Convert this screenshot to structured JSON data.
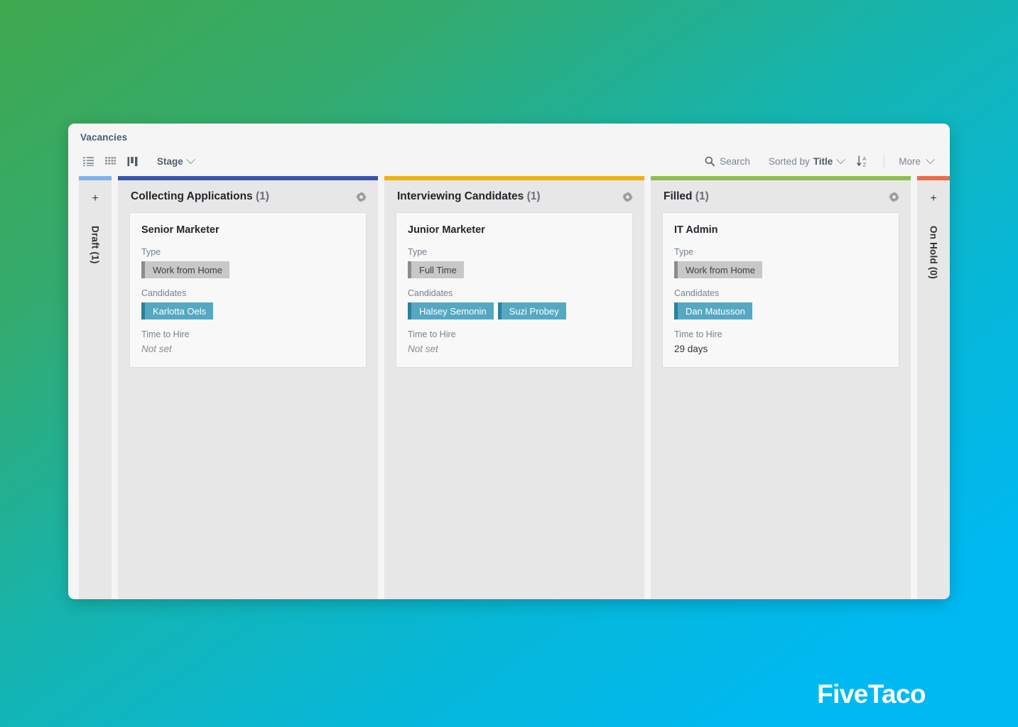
{
  "window": {
    "title": "Vacancies"
  },
  "toolbar": {
    "view_icons": [
      {
        "name": "list-view-icon",
        "label": "List view"
      },
      {
        "name": "grid-view-icon",
        "label": "Grid view"
      },
      {
        "name": "board-view-icon",
        "label": "Board view"
      }
    ],
    "stage_label": "Stage",
    "search_label": "Search",
    "sorted_by_label": "Sorted by",
    "sorted_by_value": "Title",
    "sort_direction_icon": "sort-alpha-ascending-icon",
    "more_label": "More"
  },
  "colors": {
    "draft": "#7fb2ef",
    "collecting": "#3a55ae",
    "interviewing": "#eeb111",
    "filled": "#8cbf4c",
    "onhold": "#ee6a45",
    "accent_person": "#55a8c2",
    "accent_type": "#c8c8c8",
    "brand_green": "#3ea84e",
    "brand_cyan": "#00b9f2"
  },
  "board": {
    "collapsed_left": {
      "label": "Draft (1)",
      "color": "#7fb2ef",
      "add_label": "+"
    },
    "collapsed_right": {
      "label": "On Hold (0)",
      "color": "#ee6a45",
      "add_label": "+"
    },
    "columns": [
      {
        "title": "Collecting Applications",
        "count": "(1)",
        "color": "#3a55ae",
        "card": {
          "title": "Senior Marketer",
          "type_label": "Type",
          "type_tags": [
            "Work from Home"
          ],
          "candidates_label": "Candidates",
          "candidates": [
            "Karlotta Oels"
          ],
          "time_label": "Time to Hire",
          "time_value": "Not set",
          "time_muted": true
        }
      },
      {
        "title": "Interviewing Candidates",
        "count": "(1)",
        "color": "#eeb111",
        "card": {
          "title": "Junior Marketer",
          "type_label": "Type",
          "type_tags": [
            "Full Time"
          ],
          "candidates_label": "Candidates",
          "candidates": [
            "Halsey Semonin",
            "Suzi Probey"
          ],
          "time_label": "Time to Hire",
          "time_value": "Not set",
          "time_muted": true
        }
      },
      {
        "title": "Filled",
        "count": "(1)",
        "color": "#8cbf4c",
        "card": {
          "title": "IT Admin",
          "type_label": "Type",
          "type_tags": [
            "Work from Home"
          ],
          "candidates_label": "Candidates",
          "candidates": [
            "Dan Matusson"
          ],
          "time_label": "Time to Hire",
          "time_value": "29 days",
          "time_muted": false
        }
      }
    ]
  },
  "brand": {
    "logo_text": "FiveTaco"
  }
}
